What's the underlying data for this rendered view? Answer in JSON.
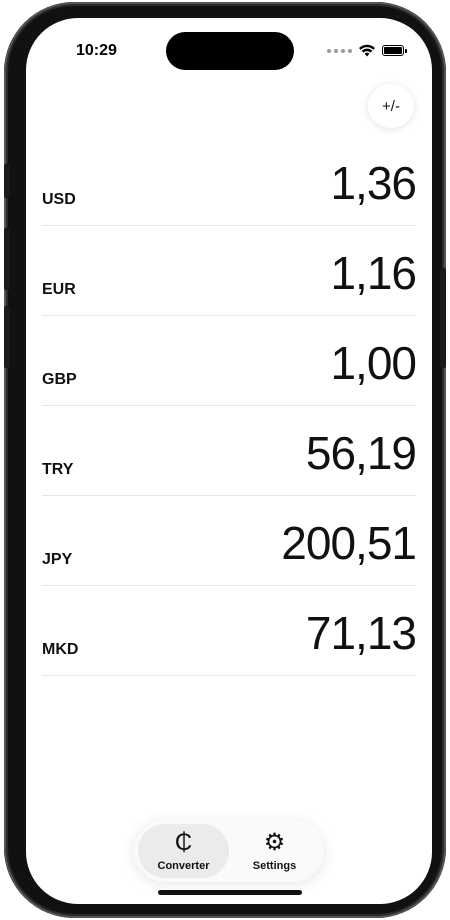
{
  "status_bar": {
    "time": "10:29"
  },
  "toolbar": {
    "sign_toggle_label": "+/-"
  },
  "currencies": [
    {
      "code": "USD",
      "amount": "1,36"
    },
    {
      "code": "EUR",
      "amount": "1,16"
    },
    {
      "code": "GBP",
      "amount": "1,00"
    },
    {
      "code": "TRY",
      "amount": "56,19"
    },
    {
      "code": "JPY",
      "amount": "200,51"
    },
    {
      "code": "MKD",
      "amount": "71,13"
    }
  ],
  "tabbar": {
    "tabs": [
      {
        "label": "Converter",
        "icon": "cent-sign-icon",
        "glyph": "₵",
        "active": true
      },
      {
        "label": "Settings",
        "icon": "gear-icon",
        "glyph": "⚙",
        "active": false
      }
    ]
  }
}
